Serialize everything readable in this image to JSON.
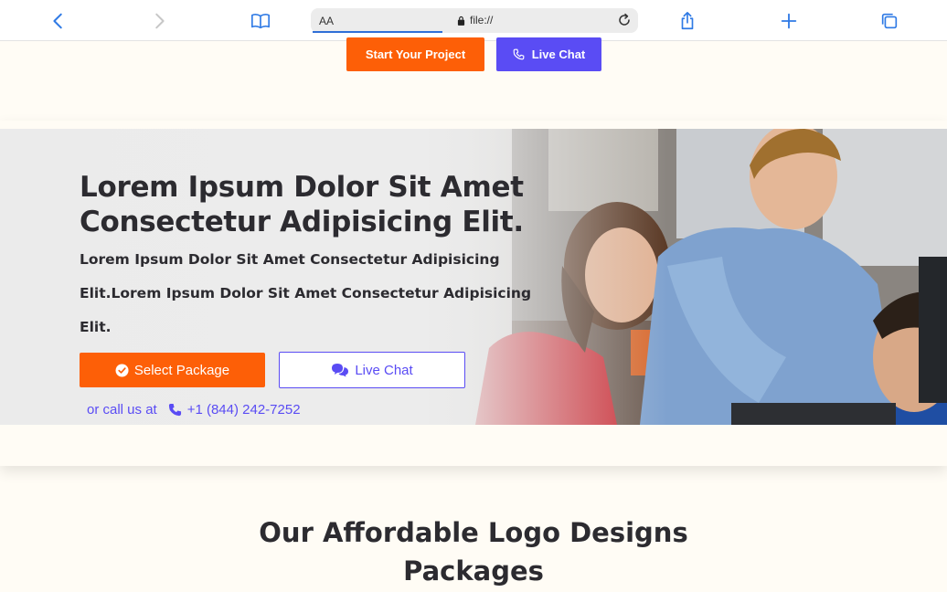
{
  "browser": {
    "text_size_label": "AA",
    "url": "file://",
    "icons": [
      "back-icon",
      "forward-icon",
      "bookmarks-icon",
      "lock-icon",
      "reload-icon",
      "share-icon",
      "new-tab-icon",
      "tabs-icon"
    ]
  },
  "top_cta": {
    "start_label": "Start Your Project",
    "live_chat_label": "Live Chat"
  },
  "hero": {
    "title": "Lorem Ipsum Dolor Sit Amet Consectetur Adipisicing Elit.",
    "subtitle": "Lorem Ipsum Dolor Sit Amet Consectetur Adipisicing Elit.Lorem Ipsum Dolor Sit Amet Consectetur Adipisicing Elit.",
    "select_package_label": "Select Package",
    "live_chat_label": "Live Chat",
    "call_prefix": "or call us at",
    "phone": "+1 (844) 242-7252"
  },
  "section": {
    "title": "Our Affordable Logo Designs Packages"
  },
  "colors": {
    "accent_orange": "#fd5f07",
    "accent_purple": "#5a4cf4",
    "page_background": "#fffcf5",
    "text_dark": "#2c2b30",
    "ios_blue": "#2f7ae5"
  }
}
